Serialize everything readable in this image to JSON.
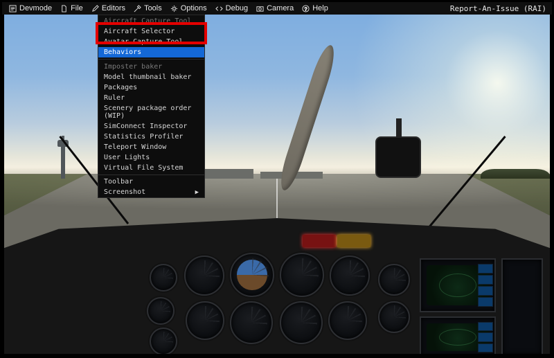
{
  "menubar": {
    "devmode_label": "Devmode",
    "items": [
      {
        "label": "File",
        "icon": "file-icon"
      },
      {
        "label": "Editors",
        "icon": "pencil-icon"
      },
      {
        "label": "Tools",
        "icon": "wrench-icon"
      },
      {
        "label": "Options",
        "icon": "gear-icon"
      },
      {
        "label": "Debug",
        "icon": "code-icon"
      },
      {
        "label": "Camera",
        "icon": "camera-icon"
      },
      {
        "label": "Help",
        "icon": "help-icon"
      }
    ],
    "rai_label": "Report-An-Issue (RAI)"
  },
  "tools_menu": {
    "section1_label": "Aircraft Capture Tool",
    "group1": [
      "Aircraft Selector",
      "Avatar Capture Tool",
      "Behaviors"
    ],
    "section2_label": "Imposter baker",
    "group2": [
      "Model thumbnail baker",
      "Packages",
      "Ruler",
      "Scenery package order (WIP)",
      "SimConnect Inspector",
      "Statistics Profiler",
      "Teleport Window",
      "User Lights",
      "Virtual File System"
    ],
    "group3": [
      "Toolbar",
      "Screenshot"
    ],
    "selected_index": 2,
    "submenu_item": "Screenshot"
  }
}
